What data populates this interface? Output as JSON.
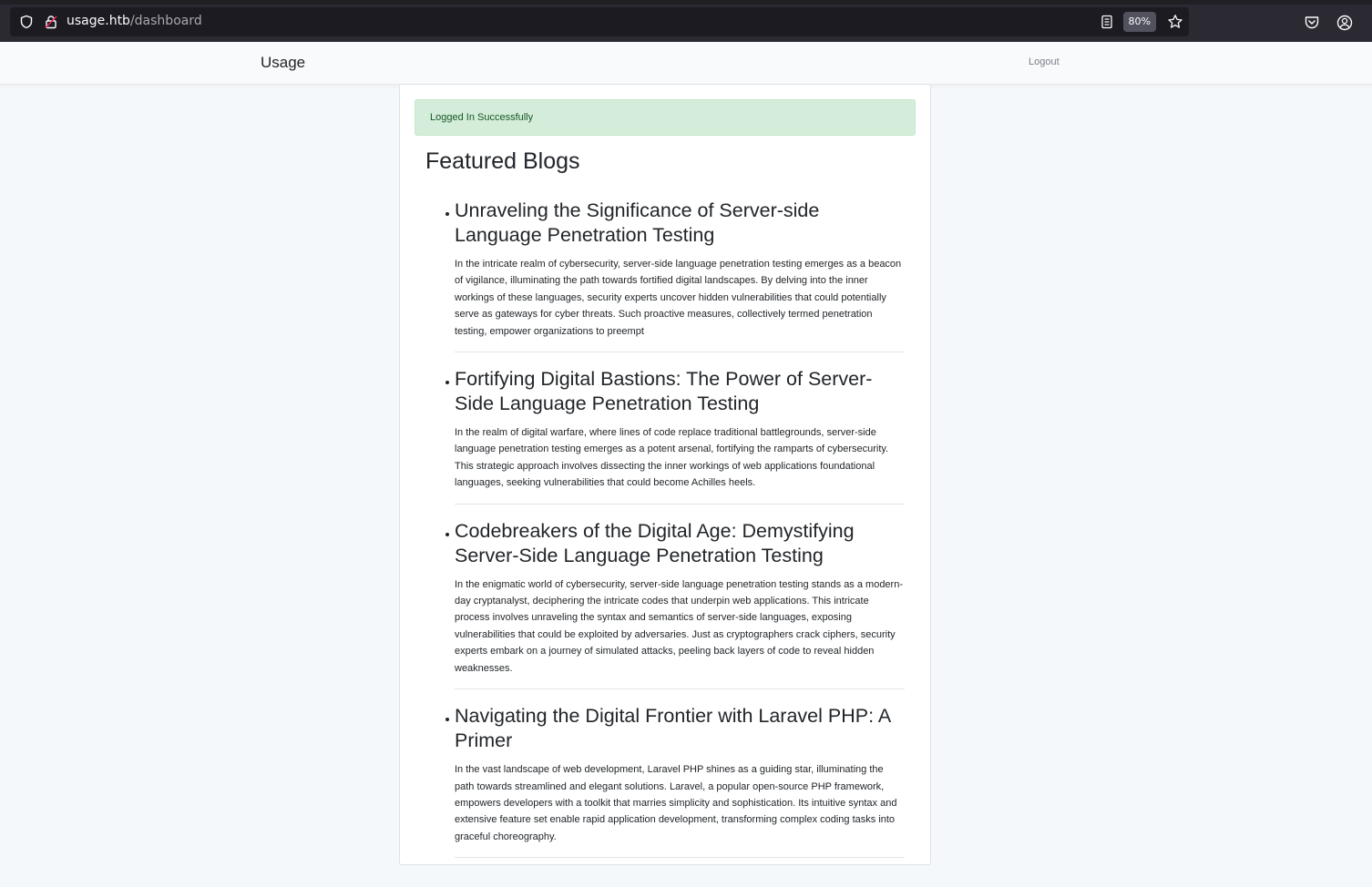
{
  "browser": {
    "url_host": "usage.htb",
    "url_path": "/dashboard",
    "zoom": "80%"
  },
  "navbar": {
    "brand": "Usage",
    "logout": "Logout"
  },
  "alert": {
    "message": "Logged In Successfully"
  },
  "main": {
    "heading": "Featured Blogs",
    "blogs": [
      {
        "title": "Unraveling the Significance of Server-side Language Penetration Testing",
        "text": "In the intricate realm of cybersecurity, server-side language penetration testing emerges as a beacon of vigilance, illuminating the path towards fortified digital landscapes. By delving into the inner workings of these languages, security experts uncover hidden vulnerabilities that could potentially serve as gateways for cyber threats. Such proactive measures, collectively termed penetration testing, empower organizations to preempt"
      },
      {
        "title": "Fortifying Digital Bastions: The Power of Server-Side Language Penetration Testing",
        "text": "In the realm of digital warfare, where lines of code replace traditional battlegrounds, server-side language penetration testing emerges as a potent arsenal, fortifying the ramparts of cybersecurity. This strategic approach involves dissecting the inner workings of web applications foundational languages, seeking vulnerabilities that could become Achilles heels."
      },
      {
        "title": "Codebreakers of the Digital Age: Demystifying Server-Side Language Penetration Testing",
        "text": "In the enigmatic world of cybersecurity, server-side language penetration testing stands as a modern-day cryptanalyst, deciphering the intricate codes that underpin web applications. This intricate process involves unraveling the syntax and semantics of server-side languages, exposing vulnerabilities that could be exploited by adversaries. Just as cryptographers crack ciphers, security experts embark on a journey of simulated attacks, peeling back layers of code to reveal hidden weaknesses."
      },
      {
        "title": "Navigating the Digital Frontier with Laravel PHP: A Primer",
        "text": "In the vast landscape of web development, Laravel PHP shines as a guiding star, illuminating the path towards streamlined and elegant solutions. Laravel, a popular open-source PHP framework, empowers developers with a toolkit that marries simplicity and sophistication. Its intuitive syntax and extensive feature set enable rapid application development, transforming complex coding tasks into graceful choreography."
      }
    ]
  }
}
